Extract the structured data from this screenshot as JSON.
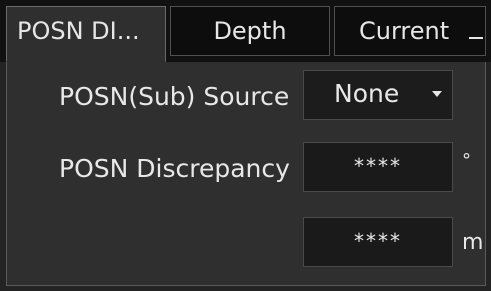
{
  "tabs": [
    {
      "label": "POSN DI...",
      "active": true
    },
    {
      "label": "Depth",
      "active": false
    },
    {
      "label": "Current",
      "active": false
    }
  ],
  "posn_source": {
    "label": "POSN(Sub) Source",
    "value": "None"
  },
  "posn_discrepancy": {
    "label": "POSN Discrepancy",
    "angle_value": "****",
    "angle_unit": "°",
    "distance_value": "****",
    "distance_unit": "m"
  },
  "colors": {
    "background": "#2f2f2f",
    "field_background": "#1a1a1a",
    "text": "#e8e8e8"
  }
}
